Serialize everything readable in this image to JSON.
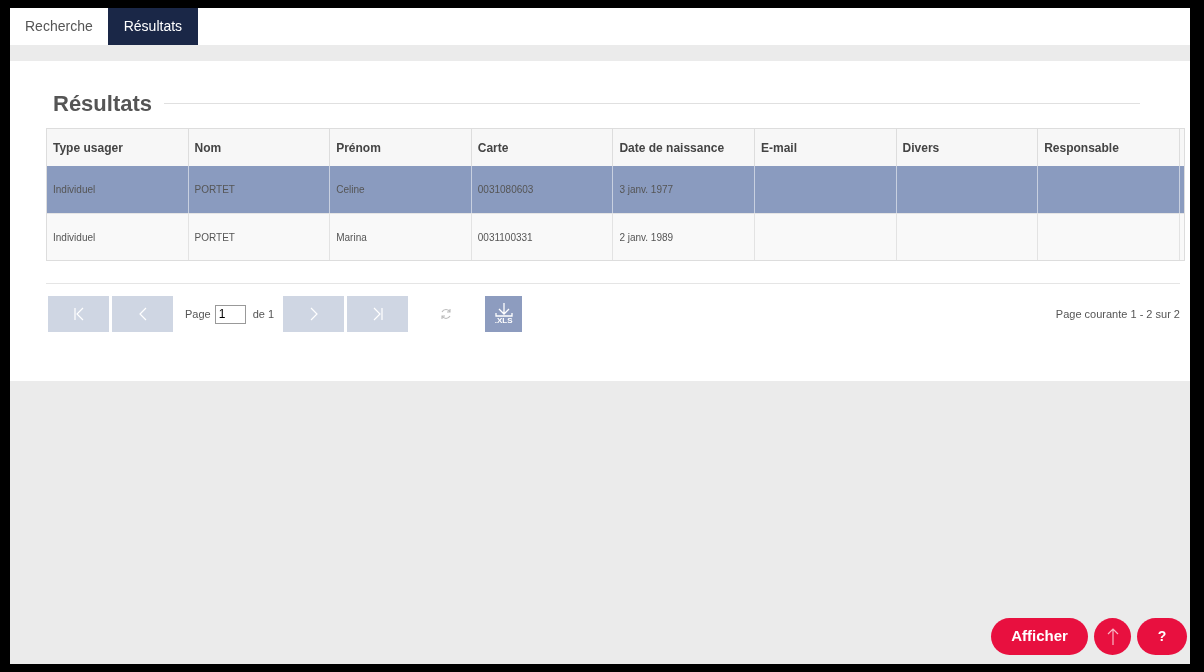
{
  "tabs": [
    {
      "label": "Recherche",
      "selected": false
    },
    {
      "label": "Résultats",
      "selected": true
    }
  ],
  "section_title": "Résultats",
  "table": {
    "columns": [
      "Type usager",
      "Nom",
      "Prénom",
      "Carte",
      "Date de naissance",
      "E-mail",
      "Divers",
      "Responsable"
    ],
    "rows": [
      {
        "selected": true,
        "cells": [
          "Individuel",
          "PORTET",
          "Celine",
          "0031080603",
          "3 janv. 1977",
          "",
          "",
          ""
        ]
      },
      {
        "selected": false,
        "cells": [
          "Individuel",
          "PORTET",
          "Marina",
          "0031100331",
          "2 janv. 1989",
          "",
          "",
          ""
        ]
      }
    ]
  },
  "pager": {
    "page_label": "Page",
    "page_value": "1",
    "of_label": "de 1",
    "xls_label": ".XLS",
    "summary": "Page courante 1 - 2 sur 2"
  },
  "buttons": {
    "show": "Afficher",
    "help": "?"
  }
}
